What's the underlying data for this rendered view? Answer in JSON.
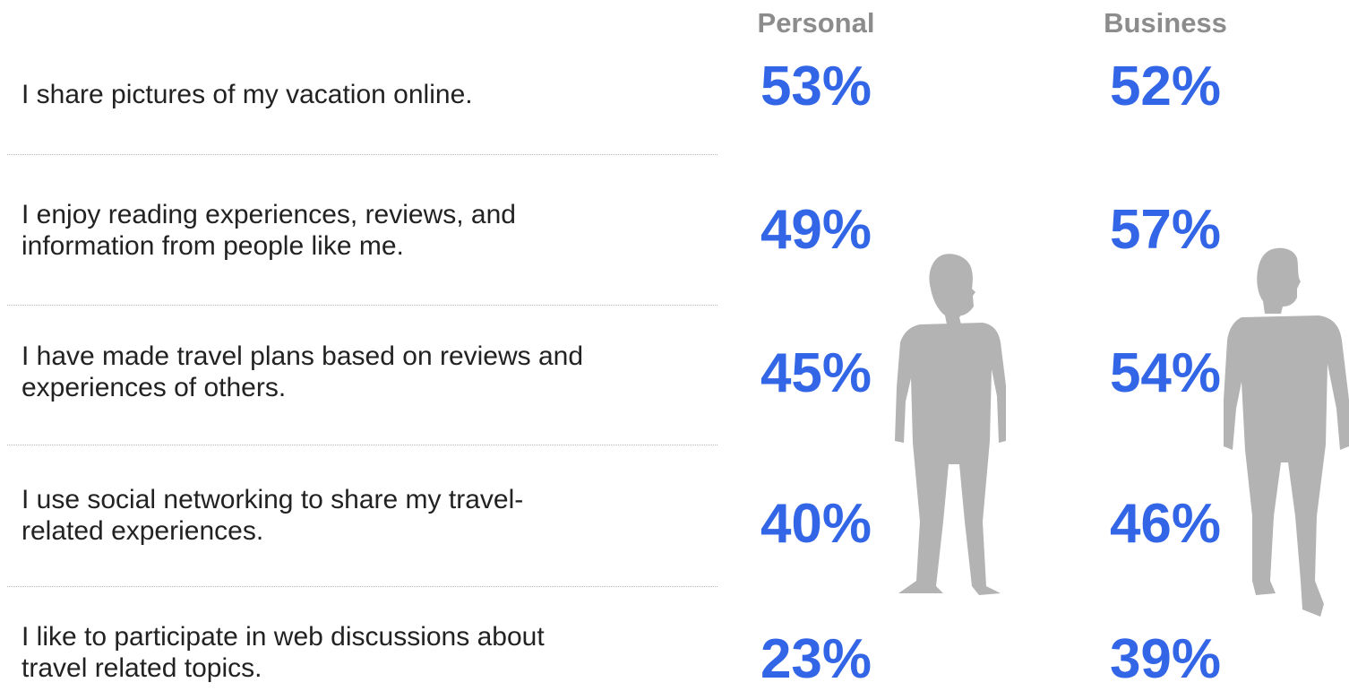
{
  "chart_data": {
    "type": "table",
    "columns": [
      "Personal",
      "Business"
    ],
    "rows": [
      {
        "label": "I share pictures of my vacation online.",
        "personal": "53%",
        "business": "52%"
      },
      {
        "label": "I enjoy reading experiences, reviews, and\ninformation from people like me.",
        "personal": "49%",
        "business": "57%"
      },
      {
        "label": "I have made travel plans based on reviews and\nexperiences of others.",
        "personal": "45%",
        "business": "54%"
      },
      {
        "label": "I use social networking to share my travel-\nrelated experiences.",
        "personal": "40%",
        "business": "46%"
      },
      {
        "label": "I like to participate in web discussions about\ntravel related topics.",
        "personal": "23%",
        "business": "39%"
      }
    ],
    "value_color": "#3366e6",
    "header_color": "#8c8c8c",
    "silhouette_color": "#b3b3b3"
  }
}
